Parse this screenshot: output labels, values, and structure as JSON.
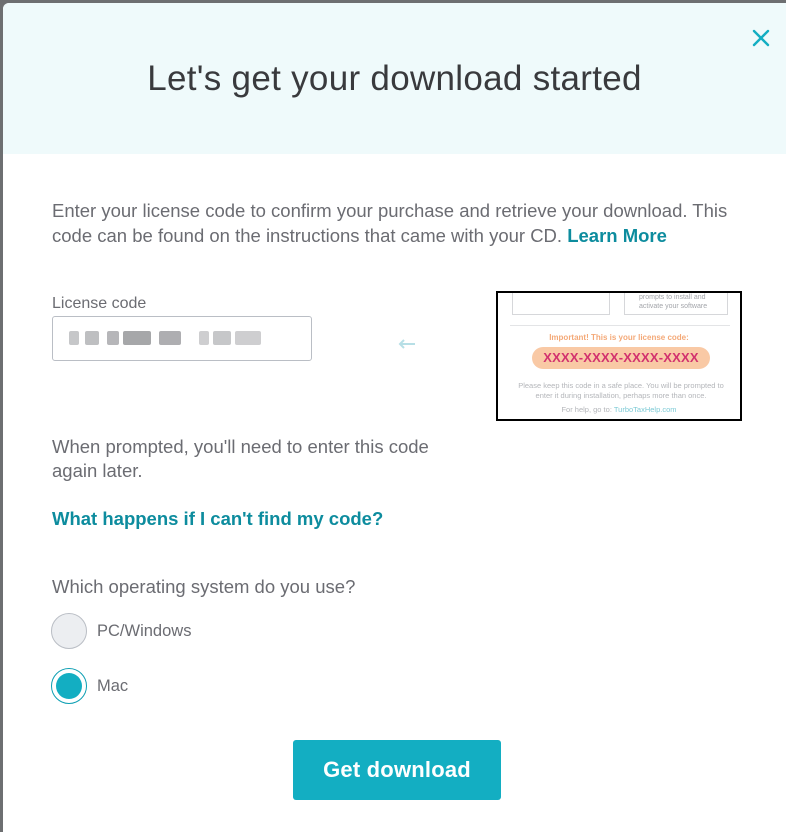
{
  "modal": {
    "title": "Let's get your download started",
    "close_icon": "close-icon"
  },
  "intro": {
    "text": "Enter your license code to confirm your purchase and retrieve your download. This code can be found on the instructions that came with your CD.",
    "learn_more": "Learn More"
  },
  "license": {
    "label": "License code",
    "value": "",
    "note": "value obscured in screenshot"
  },
  "example_card": {
    "right_box_text": "prompts to install and activate your software",
    "important": "Important! This is your license code:",
    "code": "XXXX-XXXX-XXXX-XXXX",
    "keep_text": "Please keep this code in a safe place. You will be prompted to enter it during installation, perhaps more than once.",
    "help_prefix": "For help, go to:",
    "help_link": "TurboTaxHelp.com"
  },
  "prompted": {
    "text": "When prompted, you'll need to enter this code again later."
  },
  "cant_find_link": "What happens if I can't find my code?",
  "os": {
    "question": "Which operating system do you use?",
    "options": [
      {
        "label": "PC/Windows",
        "selected": false
      },
      {
        "label": "Mac",
        "selected": true
      }
    ]
  },
  "actions": {
    "get_download": "Get download"
  },
  "colors": {
    "accent": "#13aec2",
    "link": "#0d8c9e",
    "header_bg": "#effafb",
    "code_highlight": "#f9c9a5",
    "code_text": "#d2326e"
  }
}
